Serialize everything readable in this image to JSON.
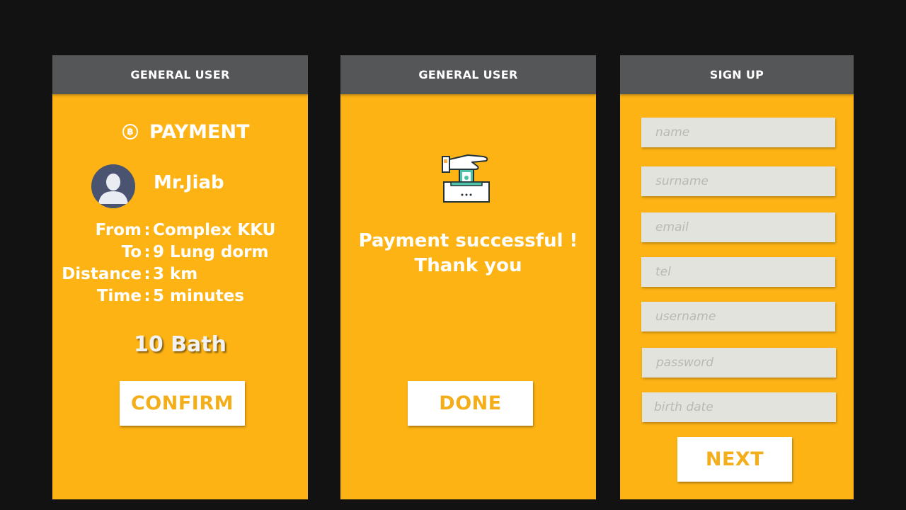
{
  "colors": {
    "background": "#121212",
    "panel": "#FDB314",
    "header": "#555658",
    "button_text": "#F4AE1A",
    "field": "#E3E3DE"
  },
  "payment_screen": {
    "header": "GENERAL USER",
    "title": "PAYMENT",
    "title_icon": "baht-coin-icon",
    "avatar_icon": "user-avatar-icon",
    "driver_name": "Mr.Jiab",
    "details": [
      {
        "label": "From",
        "value": "Complex KKU"
      },
      {
        "label": "To",
        "value": "9 Lung dorm"
      },
      {
        "label": "Distance",
        "value": "3 km"
      },
      {
        "label": "Time",
        "value": "5 minutes"
      }
    ],
    "price": "10 Bath",
    "confirm_label": "CONFIRM"
  },
  "success_screen": {
    "header": "GENERAL USER",
    "icon": "hand-deposit-money-icon",
    "message_line1": "Payment successful !",
    "message_line2": "Thank you",
    "done_label": "DONE"
  },
  "signup_screen": {
    "header": "SIGN UP",
    "fields": [
      {
        "placeholder": "name"
      },
      {
        "placeholder": "surname"
      },
      {
        "placeholder": "email"
      },
      {
        "placeholder": "tel"
      },
      {
        "placeholder": "username"
      },
      {
        "placeholder": "password"
      },
      {
        "placeholder": "birth date"
      }
    ],
    "next_label": "NEXT"
  }
}
